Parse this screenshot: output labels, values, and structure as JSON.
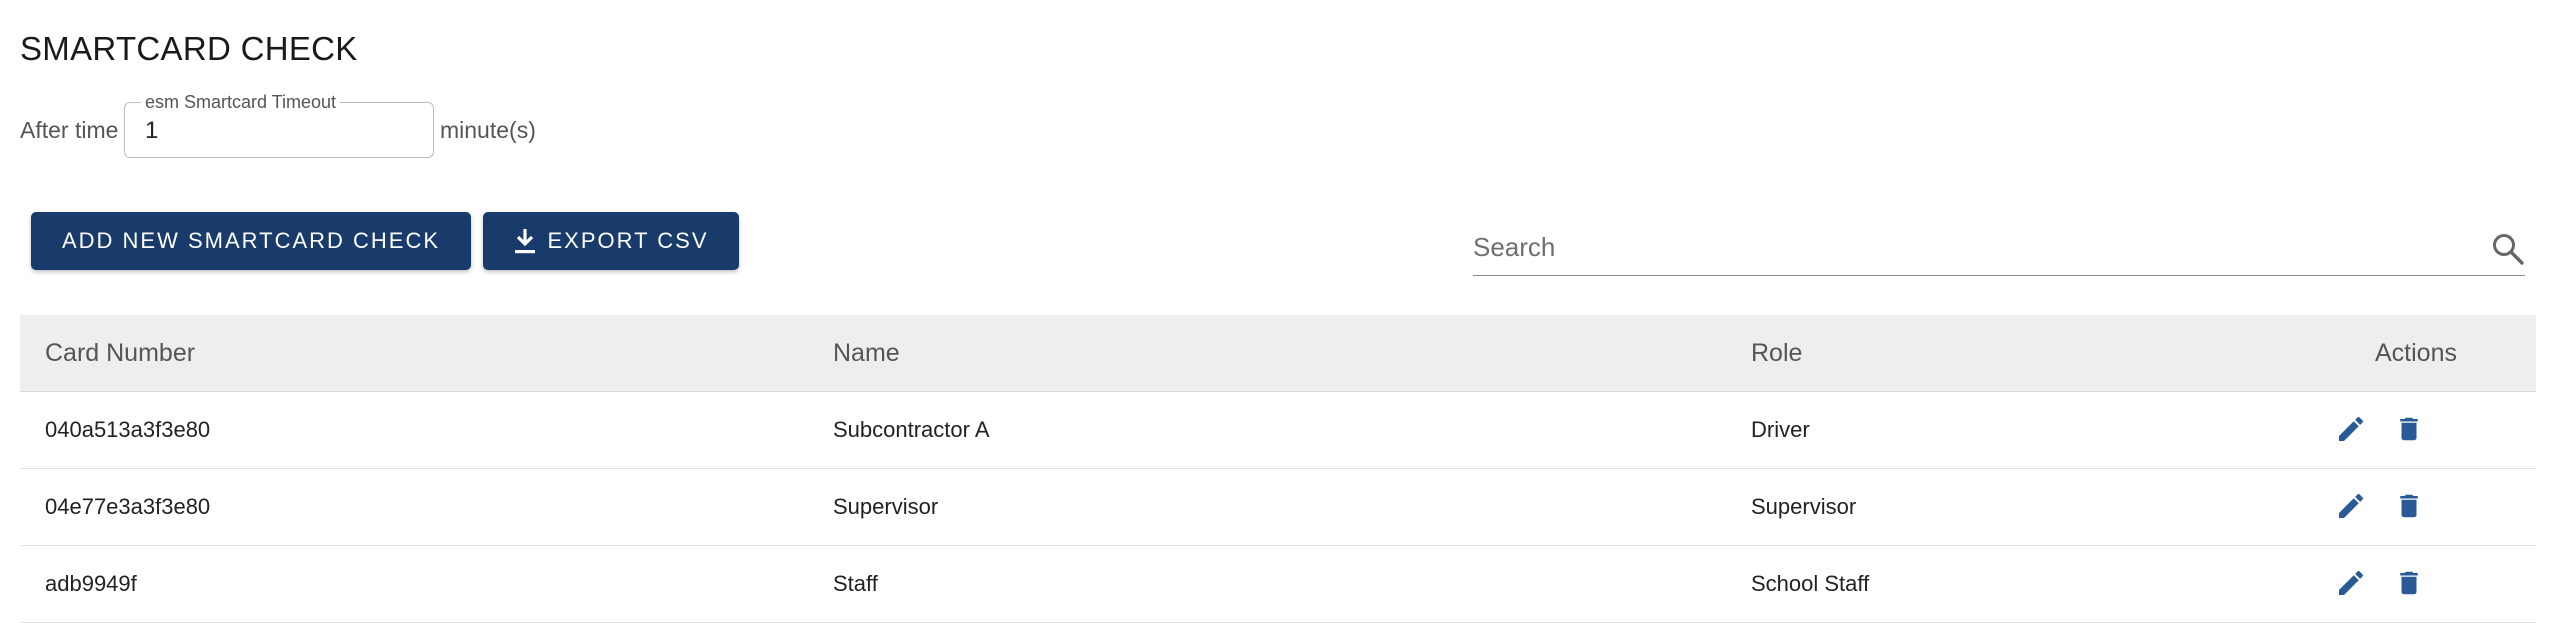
{
  "page": {
    "title": "SMARTCARD CHECK"
  },
  "timeout": {
    "prefix": "After time",
    "field_label": "esm Smartcard Timeout",
    "value": "1",
    "suffix": "minute(s)"
  },
  "toolbar": {
    "add_label": "ADD NEW SMARTCARD CHECK",
    "export_label": "EXPORT CSV",
    "export_icon": "download-icon"
  },
  "search": {
    "placeholder": "Search",
    "icon": "search-icon"
  },
  "table": {
    "columns": [
      "Card Number",
      "Name",
      "Role",
      "Actions"
    ],
    "rows": [
      {
        "card": "040a513a3f3e80",
        "name": "Subcontractor A",
        "role": "Driver"
      },
      {
        "card": "04e77e3a3f3e80",
        "name": "Supervisor",
        "role": "Supervisor"
      },
      {
        "card": "adb9949f",
        "name": "Staff",
        "role": "School Staff"
      }
    ],
    "action_icons": [
      "edit-icon",
      "delete-icon"
    ]
  },
  "colors": {
    "primary": "#183b6b",
    "action_icon": "#2a5a96",
    "header_bg": "#eeeeee"
  }
}
